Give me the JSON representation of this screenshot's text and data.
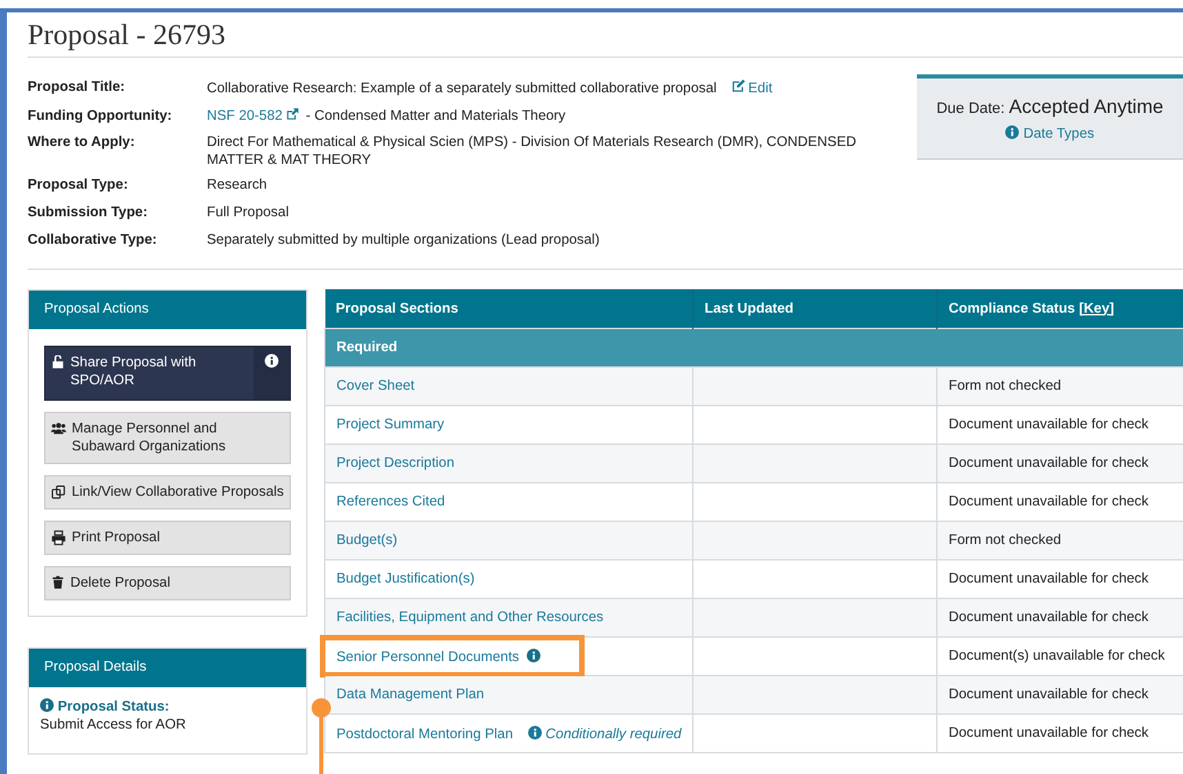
{
  "header": {
    "title": "Proposal - 26793"
  },
  "details": [
    {
      "label": "Proposal Title:",
      "kind": "edit",
      "value": "Collaborative Research: Example of a separately submitted collaborative proposal",
      "link": "Edit"
    },
    {
      "label": "Funding Opportunity:",
      "kind": "external",
      "link": "NSF 20-582",
      "value": "- Condensed Matter and Materials Theory"
    },
    {
      "label": "Where to Apply:",
      "kind": "plain",
      "value": "Direct For Mathematical & Physical Scien (MPS) - Division Of Materials Research (DMR), CONDENSED MATTER & MAT THEORY"
    },
    {
      "label": "Proposal Type:",
      "kind": "plain",
      "value": "Research"
    },
    {
      "label": "Submission Type:",
      "kind": "plain",
      "value": "Full Proposal"
    },
    {
      "label": "Collaborative Type:",
      "kind": "plain",
      "value": "Separately submitted by multiple organizations (Lead proposal)"
    }
  ],
  "due_date": {
    "label": "Due Date:",
    "value": "Accepted Anytime",
    "link": "Date Types"
  },
  "actions": {
    "title": "Proposal Actions",
    "buttons": [
      {
        "kind": "share",
        "label": "Share Proposal with SPO/AOR"
      },
      {
        "kind": "manage",
        "label": "Manage Personnel and Subaward Organizations"
      },
      {
        "kind": "link",
        "label": "Link/View Collaborative Proposals"
      },
      {
        "kind": "print",
        "label": "Print Proposal"
      },
      {
        "kind": "delete",
        "label": "Delete Proposal"
      }
    ]
  },
  "proposal_details": {
    "title": "Proposal Details",
    "status_label": "Proposal Status:",
    "status": "Submit Access for AOR"
  },
  "table": {
    "columns": [
      "Proposal Sections",
      "Last Updated",
      "Compliance Status"
    ],
    "key_link": "[Key]",
    "group": "Required",
    "rows": [
      {
        "name": "Cover Sheet",
        "status": "Form not checked",
        "info": false,
        "highlighted": false
      },
      {
        "name": "Project Summary",
        "status": "Document unavailable for check",
        "info": false,
        "highlighted": false
      },
      {
        "name": "Project Description",
        "status": "Document unavailable for check",
        "info": false,
        "highlighted": false
      },
      {
        "name": "References Cited",
        "status": "Document unavailable for check",
        "info": false,
        "highlighted": false
      },
      {
        "name": "Budget(s)",
        "status": "Form not checked",
        "info": false,
        "highlighted": false
      },
      {
        "name": "Budget Justification(s)",
        "status": "Document unavailable for check",
        "info": false,
        "highlighted": false
      },
      {
        "name": "Facilities, Equipment and Other Resources",
        "status": "Document unavailable for check",
        "info": false,
        "highlighted": false
      },
      {
        "name": "Senior Personnel Documents",
        "status": "Document(s) unavailable for check",
        "info": true,
        "highlighted": true
      },
      {
        "name": "Data Management Plan",
        "status": "Document unavailable for check",
        "info": false,
        "highlighted": false
      },
      {
        "name": "Postdoctoral Mentoring Plan",
        "status": "Document unavailable for check",
        "info": false,
        "note": "Conditionally required",
        "highlighted": false
      }
    ]
  }
}
